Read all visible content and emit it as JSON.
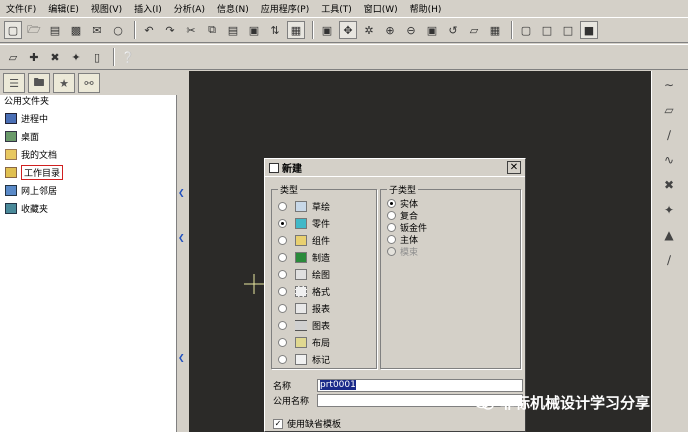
{
  "menubar": {
    "items": [
      "文件(F)",
      "编辑(E)",
      "视图(V)",
      "插入(I)",
      "分析(A)",
      "信息(N)",
      "应用程序(P)",
      "工具(T)",
      "窗口(W)",
      "帮助(H)"
    ]
  },
  "nav": {
    "header": "公用文件夹",
    "items": [
      {
        "label": "进程中",
        "icon": "monitor-icon"
      },
      {
        "label": "桌面",
        "icon": "desktop-icon"
      },
      {
        "label": "我的文档",
        "icon": "documents-icon"
      },
      {
        "label": "工作目录",
        "icon": "work-folder-icon"
      },
      {
        "label": "网上邻居",
        "icon": "network-icon"
      },
      {
        "label": "收藏夹",
        "icon": "favorites-icon"
      }
    ]
  },
  "dialog": {
    "title": "新建",
    "type_group": "类型",
    "types": [
      "草绘",
      "零件",
      "组件",
      "制造",
      "绘图",
      "格式",
      "报表",
      "图表",
      "布局",
      "标记"
    ],
    "selected_type": "零件",
    "subtype_group": "子类型",
    "subtypes": [
      "实体",
      "复合",
      "钣金件",
      "主体",
      "模束"
    ],
    "selected_subtype": "实体",
    "name_label": "名称",
    "name_value": "prt0001",
    "common_name_label": "公用名称",
    "common_name_value": "",
    "default_template_label": "使用缺省模板",
    "default_template_checked": true
  },
  "watermark": "非标机械设计学习分享",
  "colors": {
    "canvas": "#2b2a28",
    "chrome": "#d4d0c8",
    "selection_outline": "#d02020",
    "name_highlight": "#1a2a8a"
  }
}
